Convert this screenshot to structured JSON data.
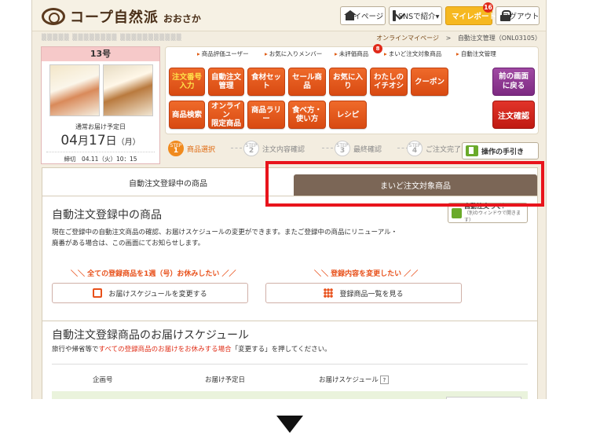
{
  "header": {
    "logo_text": "コープ自然派",
    "logo_region": "おおさか",
    "mypage": "マイページ",
    "sns": "SNSで紹介▾",
    "report": "マイレポート",
    "report_badge": "16",
    "logout": "ログアウト"
  },
  "account": {
    "name_masked": "▒▒▒▒▒ ▒▒▒▒▒▒▒▒ ▒▒▒▒▒▒▒▒▒▒▒",
    "crumb_mypage": "オンラインマイページ",
    "crumb_sep": ">",
    "crumb_current": "自動注文管理（ONL03105）"
  },
  "delivery": {
    "issue": "13号",
    "label": "通常お届け予定日",
    "month": "04",
    "month_unit": "月",
    "day": "17",
    "day_unit": "日",
    "weekday": "（月）",
    "deadline": "締切　04.11（火）10：15"
  },
  "sublinks": [
    "商品評価ユーザー",
    "お気に入りメンバー",
    "未評価商品",
    "まいど注文対象商品",
    "自動注文管理"
  ],
  "sublink_badge": "8",
  "menu": {
    "row1": [
      "注文番号\n入力",
      "自動注文\n管理",
      "食材セット",
      "セール商品",
      "お気に入り",
      "わたしの\nイチオシ",
      "クーポン"
    ],
    "row2": [
      "商品検索",
      "オンライン\n限定商品",
      "商品ラリー",
      "食べ方・\n使い方",
      "レシピ"
    ],
    "back": "前の画面\nに戻る",
    "confirm": "注文確認"
  },
  "steps": [
    {
      "num": "1",
      "label": "商品選択"
    },
    {
      "num": "2",
      "label": "注文内容確認"
    },
    {
      "num": "3",
      "label": "最終確認"
    },
    {
      "num": "4",
      "label": "ご注文完了"
    }
  ],
  "step_word": "STEP",
  "manual": "操作の手引き",
  "tabs": {
    "left": "自動注文登録中の商品",
    "right": "まいど注文対象商品"
  },
  "section": {
    "title": "自動注文登録中の商品",
    "what_btn": "自動注文って？",
    "what_sub": "（別のウィンドウで開きます）",
    "desc_line1": "現在ご登録中の自動注文商品の確認、お届けスケジュールの変更ができます。またご登録中の商品にリニューアル・",
    "desc_line2": "廃番がある場合は、この画面にてお知らせします。",
    "cta1_head": "＼＼ 全ての登録商品を1週（号）お休みしたい ／／",
    "cta1_btn": "お届けスケジュールを変更する",
    "cta2_head": "＼＼ 登録内容を変更したい ／／",
    "cta2_btn": "登録商品一覧を見る"
  },
  "schedule": {
    "title": "自動注文登録商品のお届けスケジュール",
    "desc_pre": "旅行や帰省等で",
    "desc_red": "すべての登録商品のお届けをお休みする場合",
    "desc_post": "「変更する」を押してください。",
    "col1": "企画号",
    "col2": "お届け予定日",
    "col3": "お届けスケジュール",
    "help": "?"
  },
  "colors": {
    "orange_button": "#e05a1a",
    "purple_button": "#8a3590",
    "red_button": "#d0221a",
    "tab_active": "#7b6656",
    "highlight_box": "#e8141c",
    "pink_header": "#f6c9c9"
  }
}
